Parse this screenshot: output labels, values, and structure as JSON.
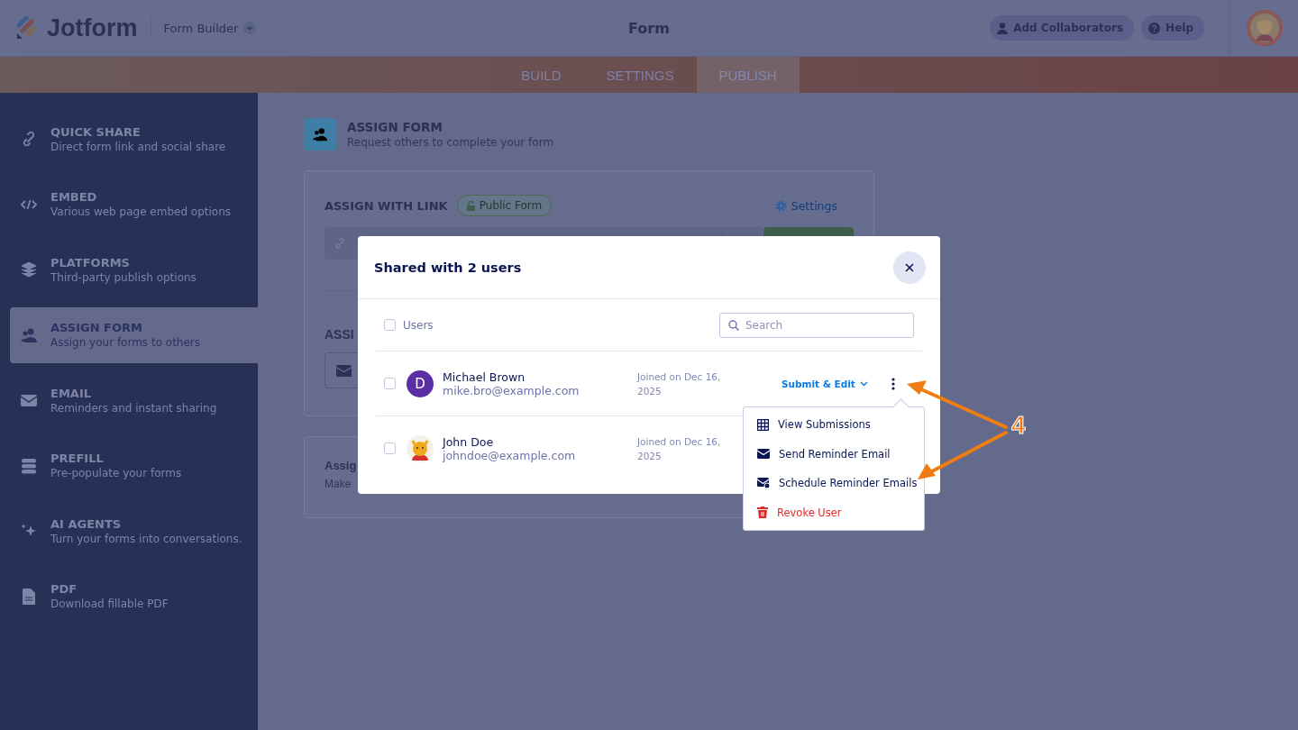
{
  "header": {
    "logo_text": "Jotform",
    "builder_menu": "Form Builder",
    "title": "Form",
    "buttons": [
      {
        "label": "Add Collaborators",
        "kind": "person"
      },
      {
        "label": "Help",
        "kind": "help"
      }
    ]
  },
  "tabs": [
    {
      "label": "BUILD",
      "selected": false
    },
    {
      "label": "SETTINGS",
      "selected": false
    },
    {
      "label": "PUBLISH",
      "selected": true
    }
  ],
  "sidebar": {
    "items": [
      {
        "title": "QUICK SHARE",
        "subtitle": "Direct form link and social share",
        "selected": false
      },
      {
        "title": "EMBED",
        "subtitle": "Various web page embed options",
        "selected": false
      },
      {
        "title": "PLATFORMS",
        "subtitle": "Third-party publish options",
        "selected": false
      },
      {
        "title": "ASSIGN FORM",
        "subtitle": "Assign your forms to others",
        "selected": true
      },
      {
        "title": "EMAIL",
        "subtitle": "Reminders and instant sharing",
        "selected": false
      },
      {
        "title": "PREFILL",
        "subtitle": "Pre-populate your forms",
        "selected": false
      },
      {
        "title": "AI AGENTS",
        "subtitle": "Turn your forms into conversations.",
        "selected": false
      },
      {
        "title": "PDF",
        "subtitle": "Download fillable PDF",
        "selected": false
      }
    ]
  },
  "main": {
    "title": "ASSIGN FORM",
    "subtitle": "Request others to complete your form",
    "link_card": {
      "heading": "ASSIGN WITH LINK",
      "badge": "Public Form",
      "settings": "Settings",
      "second_heading": "ASSI"
    },
    "third_card": {
      "heading": "Assig",
      "text": "Make"
    }
  },
  "modal": {
    "title": "Shared with 2 users",
    "select_all": {
      "label": "Users",
      "checked": false
    },
    "search": {
      "placeholder": "Search"
    },
    "users": [
      {
        "name": "Michael Brown",
        "email": "mike.bro@example.com",
        "joined": "Joined on Dec 16, 2025",
        "permission": "Submit & Edit",
        "avatar_letter": "D",
        "checked": false
      },
      {
        "name": "John Doe",
        "email": "johndoe@example.com",
        "joined": "Joined on Dec 16, 2025",
        "checked": false
      }
    ]
  },
  "menu": {
    "items": [
      {
        "label": "View Submissions",
        "kind": "table"
      },
      {
        "label": "Send Reminder Email",
        "kind": "mail"
      },
      {
        "label": "Schedule Reminder Emails",
        "kind": "schedule"
      },
      {
        "label": "Revoke User",
        "kind": "danger"
      }
    ]
  },
  "callout": "4"
}
